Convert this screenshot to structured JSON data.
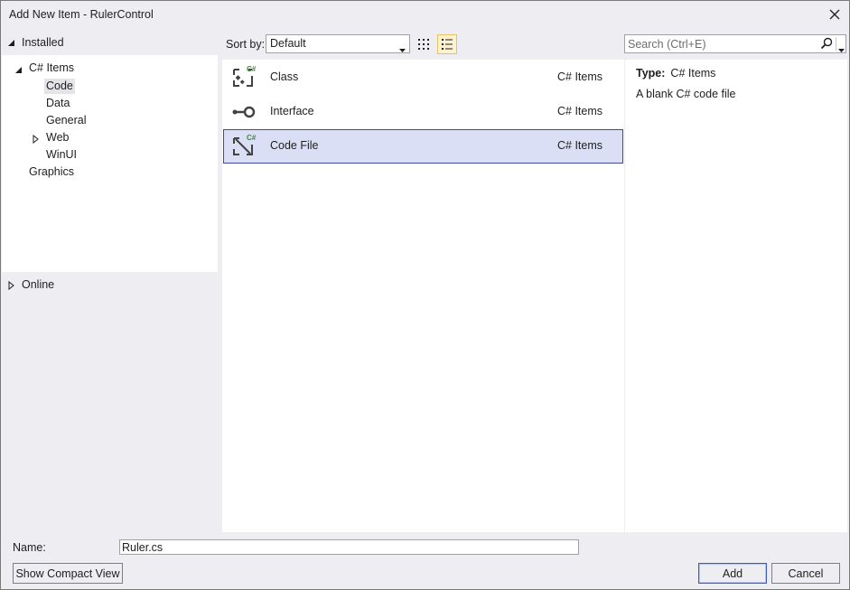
{
  "window": {
    "title": "Add New Item - RulerControl"
  },
  "left_pane": {
    "installed_label": "Installed",
    "tree": [
      {
        "label": "C# Items"
      },
      {
        "label": "Code"
      },
      {
        "label": "Data"
      },
      {
        "label": "General"
      },
      {
        "label": "Web"
      },
      {
        "label": "WinUI"
      },
      {
        "label": "Graphics"
      }
    ],
    "online_label": "Online"
  },
  "toolbar": {
    "sort_label": "Sort by:",
    "sort_value": "Default",
    "search_placeholder": "Search (Ctrl+E)"
  },
  "items": [
    {
      "name": "Class",
      "category": "C# Items",
      "icon": "class-icon"
    },
    {
      "name": "Interface",
      "category": "C# Items",
      "icon": "interface-icon"
    },
    {
      "name": "Code File",
      "category": "C# Items",
      "icon": "code-file-icon",
      "selected": true
    }
  ],
  "details": {
    "type_label": "Type:",
    "type_value": "C# Items",
    "description": "A blank C# code file"
  },
  "footer": {
    "name_label": "Name:",
    "name_value": "Ruler.cs",
    "compact_view_label": "Show Compact View",
    "add_label": "Add",
    "cancel_label": "Cancel"
  },
  "colors": {
    "window_bg": "#eeeef2",
    "selection_bg": "#dadff6",
    "selection_border": "#3d4b99",
    "csharp_badge": "#388a34"
  }
}
